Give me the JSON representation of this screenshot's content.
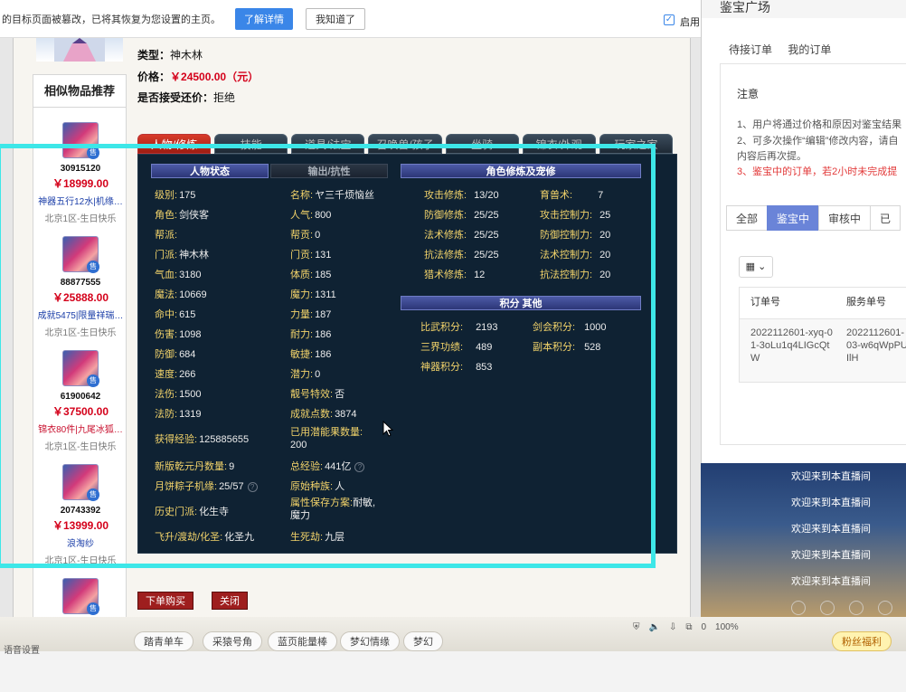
{
  "notify": {
    "message": "的目标页面被篡改，已将其恢复为您设置的主页。",
    "learn_more": "了解详情",
    "got_it": "我知道了",
    "checkbox_label": "启用"
  },
  "item": {
    "type_label": "类型：",
    "type_value": "神木林",
    "price_label": "价格：",
    "price_value": "￥24500.00（元）",
    "bargain_label": "是否接受还价：",
    "bargain_value": "拒绝"
  },
  "similar": {
    "title": "相似物品推荐",
    "items": [
      {
        "id": "30915120",
        "price": "￥18999.00",
        "desc": "神器五行12水|机缘…",
        "desc_color": "blue",
        "server": "北京1区-生日快乐"
      },
      {
        "id": "88877555",
        "price": "￥25888.00",
        "desc": "成就5475|限量祥瑞…",
        "desc_color": "blue",
        "server": "北京1区-生日快乐"
      },
      {
        "id": "61900642",
        "price": "￥37500.00",
        "desc": "锦衣80件|九尾冰狐…",
        "desc_color": "red",
        "server": "北京1区-生日快乐"
      },
      {
        "id": "20743392",
        "price": "￥13999.00",
        "desc": "浪淘纱",
        "desc_color": "blue",
        "server": "北京1区-生日快乐"
      }
    ],
    "badge": "售"
  },
  "tabs": [
    "人物/修炼",
    "技能",
    "道具/法宝",
    "召唤兽/孩子",
    "坐骑",
    "锦衣/外观",
    "玩家之家"
  ],
  "panel": {
    "sec_status": "人物状态",
    "sec_output": "输出/抗性",
    "sec_cultivation": "角色修炼及宠修",
    "sec_score": "积分  其他",
    "col1": [
      {
        "k": "级别:",
        "v": "175"
      },
      {
        "k": "角色:",
        "v": "剑侠客"
      },
      {
        "k": "帮派:",
        "v": ""
      },
      {
        "k": "门派:",
        "v": "神木林"
      },
      {
        "k": "气血:",
        "v": "3180"
      },
      {
        "k": "魔法:",
        "v": "10669"
      },
      {
        "k": "命中:",
        "v": "615"
      },
      {
        "k": "伤害:",
        "v": "1098"
      },
      {
        "k": "防御:",
        "v": "684"
      },
      {
        "k": "速度:",
        "v": "266"
      },
      {
        "k": "法伤:",
        "v": "1500"
      },
      {
        "k": "法防:",
        "v": "1319"
      }
    ],
    "col2": [
      {
        "k": "名称:",
        "v": "ヤ三千烦恼丝"
      },
      {
        "k": "人气:",
        "v": "800"
      },
      {
        "k": "帮贡:",
        "v": "0"
      },
      {
        "k": "门贡:",
        "v": "131"
      },
      {
        "k": "体质:",
        "v": "185"
      },
      {
        "k": "魔力:",
        "v": "1311"
      },
      {
        "k": "力量:",
        "v": "187"
      },
      {
        "k": "耐力:",
        "v": "186"
      },
      {
        "k": "敏捷:",
        "v": "186"
      },
      {
        "k": "潜力:",
        "v": "0"
      },
      {
        "k": "靓号特效:",
        "v": "否"
      },
      {
        "k": "成就点数:",
        "v": "3874"
      }
    ],
    "exp_label": "获得经验:",
    "exp_value": "125885655",
    "unused_label": "已用潜能果数量:",
    "unused_value": "200",
    "qyd_label": "新版乾元丹数量:",
    "qyd_value": "9",
    "total_exp_label": "总经验:",
    "total_exp_value": "441亿",
    "mooncake_label": "月饼粽子机缘:",
    "mooncake_value": "25/57",
    "race_label": "原始种族:",
    "race_value": "人",
    "history_label": "历史门派:",
    "history_value": "化生寺",
    "attr_label": "属性保存方案:",
    "attr_value": "耐敏,魔力",
    "fly_label": "飞升/渡劫/化圣:",
    "fly_value": "化圣九",
    "life_label": "生死劫:",
    "life_value": "九层",
    "cultivation_left": [
      {
        "k": "攻击修炼:",
        "v": "13/20"
      },
      {
        "k": "防御修炼:",
        "v": "25/25"
      },
      {
        "k": "法术修炼:",
        "v": "25/25"
      },
      {
        "k": "抗法修炼:",
        "v": "25/25"
      },
      {
        "k": "猎术修炼:",
        "v": "12"
      }
    ],
    "cultivation_right": [
      {
        "k": "育兽术:",
        "v": "7"
      },
      {
        "k": "攻击控制力:",
        "v": "25"
      },
      {
        "k": "防御控制力:",
        "v": "20"
      },
      {
        "k": "法术控制力:",
        "v": "20"
      },
      {
        "k": "抗法控制力:",
        "v": "20"
      }
    ],
    "score_left": [
      {
        "k": "比武积分:",
        "v": "2193"
      },
      {
        "k": "三界功绩:",
        "v": "489"
      },
      {
        "k": "神器积分:",
        "v": "853"
      }
    ],
    "score_right": [
      {
        "k": "剑会积分:",
        "v": "1000"
      },
      {
        "k": "副本积分:",
        "v": "528"
      }
    ]
  },
  "footer": {
    "buy": "下单购买",
    "close": "关闭"
  },
  "right": {
    "title": "鉴宝广场",
    "tab1": "待接订单",
    "tab2": "我的订单",
    "note_title": "注意",
    "note1": "1、用户将通过价格和原因对鉴宝结果",
    "note2": "2、可多次操作“编辑”修改内容，请自",
    "note2b": "内容后再次提。",
    "note3": "3、鉴宝中的订单，若2小时未完成提",
    "filters": [
      "全部",
      "鉴宝中",
      "审核中",
      "已"
    ],
    "col_order": "订单号",
    "col_service": "服务单号",
    "order_no": "2022112601-xyq-01-3oLu1q4LIGcQtW",
    "service_no": "2022112601-03-w6qWpPUIlH"
  },
  "live": {
    "messages": [
      "欢迎来到本直播间",
      "欢迎来到本直播间",
      "欢迎来到本直播间",
      "欢迎来到本直播间",
      "欢迎来到本直播间"
    ]
  },
  "bottom": {
    "voice": "语音设置",
    "pills": [
      "踏青单车",
      "采猿号角",
      "蓝页能量棒",
      "梦幻情缘",
      "梦幻"
    ],
    "zoom": "100%",
    "count": "0",
    "right_badge": "粉丝福利"
  }
}
